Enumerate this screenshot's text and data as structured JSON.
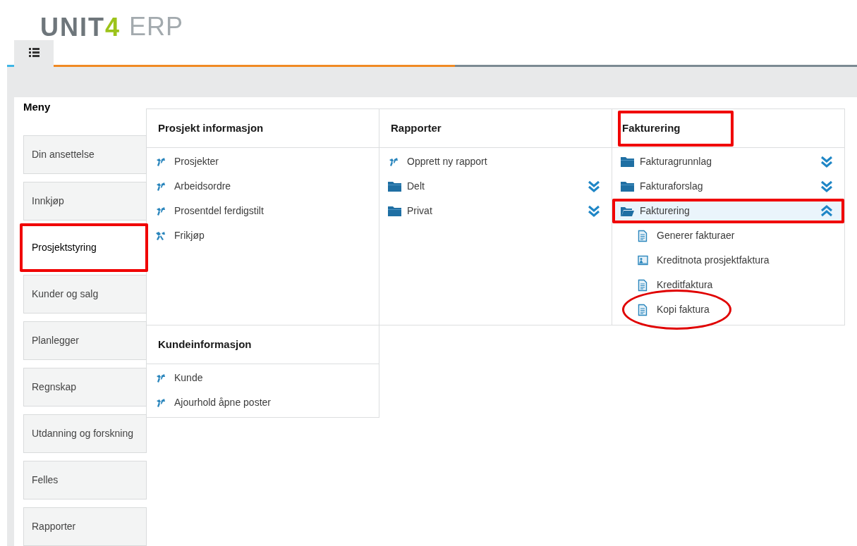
{
  "logo": {
    "name": "UNIT",
    "accent": "4",
    "product": "ERP"
  },
  "tabs": [
    {
      "kind": "menu",
      "selected": true
    }
  ],
  "menu": {
    "title": "Meny",
    "items": [
      {
        "label": "Din ansettelse",
        "selected": false,
        "boxed": false
      },
      {
        "label": "Innkjøp",
        "selected": false,
        "boxed": false
      },
      {
        "label": "Prosjektstyring",
        "selected": true,
        "boxed": true
      },
      {
        "label": "Kunder og salg",
        "selected": false,
        "boxed": false
      },
      {
        "label": "Planlegger",
        "selected": false,
        "boxed": false
      },
      {
        "label": "Regnskap",
        "selected": false,
        "boxed": false
      },
      {
        "label": "Utdanning og forskning",
        "selected": false,
        "boxed": false
      },
      {
        "label": "Felles",
        "selected": false,
        "boxed": false
      },
      {
        "label": "Rapporter",
        "selected": false,
        "boxed": false
      }
    ]
  },
  "sections": [
    {
      "title": "Prosjekt informasjon",
      "boxed": false,
      "items": [
        {
          "kind": "task",
          "label": "Prosjekter"
        },
        {
          "kind": "task",
          "label": "Arbeidsordre"
        },
        {
          "kind": "task",
          "label": "Prosentdel ferdigstilt"
        },
        {
          "kind": "tool",
          "label": "Frikjøp"
        }
      ]
    },
    {
      "title": "Rapporter",
      "boxed": false,
      "items": [
        {
          "kind": "task",
          "label": "Opprett ny rapport"
        },
        {
          "kind": "folder",
          "label": "Delt",
          "expanded": false,
          "boxed": false
        },
        {
          "kind": "folder",
          "label": "Privat",
          "expanded": false,
          "boxed": false
        }
      ]
    },
    {
      "title": "Fakturering",
      "boxed": true,
      "items": [
        {
          "kind": "folder",
          "label": "Fakturagrunnlag",
          "expanded": false,
          "boxed": false
        },
        {
          "kind": "folder",
          "label": "Fakturaforslag",
          "expanded": false,
          "boxed": false
        },
        {
          "kind": "folder",
          "label": "Fakturering",
          "expanded": true,
          "boxed": true,
          "children": [
            {
              "kind": "document",
              "label": "Generer fakturaer",
              "circled": false
            },
            {
              "kind": "form",
              "label": "Kreditnota prosjektfaktura",
              "circled": false
            },
            {
              "kind": "document",
              "label": "Kreditfaktura",
              "circled": false
            },
            {
              "kind": "document",
              "label": "Kopi faktura",
              "circled": true
            }
          ]
        }
      ]
    },
    {
      "title": "Kundeinformasjon",
      "boxed": false,
      "items": [
        {
          "kind": "task",
          "label": "Kunde"
        },
        {
          "kind": "task",
          "label": "Ajourhold åpne poster"
        }
      ]
    }
  ]
}
